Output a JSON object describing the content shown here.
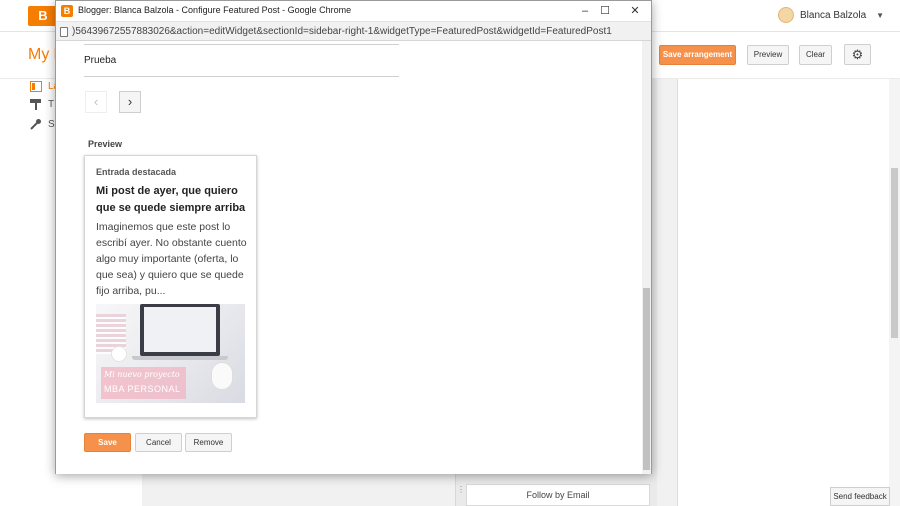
{
  "background": {
    "logo_letter": "B",
    "blog_title": "My b",
    "user_name": "Blanca Balzola",
    "buttons": {
      "save_arrangement": "Save arrangement",
      "preview": "Preview",
      "clear": "Clear"
    },
    "nav": [
      {
        "label": "La",
        "icon": "layout-icon"
      },
      {
        "label": "T",
        "icon": "theme-roller-icon"
      },
      {
        "label": "S",
        "icon": "wrench-icon"
      }
    ],
    "follow_by_email": "Follow by Email",
    "send_feedback": "Send feedback"
  },
  "popup": {
    "window_title": "Blogger: Blanca Balzola - Configure Featured Post - Google Chrome",
    "url": ")56439672557883026&action=editWidget&sectionId=sidebar-right-1&widgetType=FeaturedPost&widgetId=FeaturedPost1",
    "field_value": "Prueba",
    "preview_label": "Preview",
    "card": {
      "heading": "Entrada destacada",
      "title": "Mi post de ayer, que quiero que se quede siempre arriba",
      "snippet": "Imaginemos que este post lo escribí ayer. No obstante cuento algo muy importante (oferta, lo que sea) y quiero que se quede fijo arriba, pu...",
      "image_script": "Mi nuevo proyecto",
      "image_caption": "MBA PERSONAL"
    },
    "buttons": {
      "save": "Save",
      "cancel": "Cancel",
      "remove": "Remove"
    }
  },
  "colors": {
    "accent": "#f57d00",
    "button_orange": "#f5914b"
  }
}
